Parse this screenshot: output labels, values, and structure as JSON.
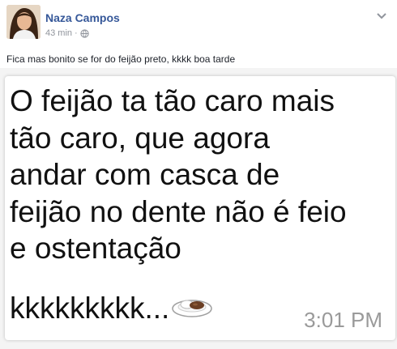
{
  "post": {
    "author": "Naza Campos",
    "time": "43 min",
    "separator": "·",
    "caption": "Fica mas bonito se for do feijão preto, kkkk boa tarde"
  },
  "image": {
    "message": "O feijão ta tão caro mais\ntão caro, que agora\nandar com casca de\nfeijão no dente não é feio\ne ostentação",
    "laugh": "kkkkkkkkk...",
    "emoji": "rice-and-beans-plate-icon",
    "timestamp": "3:01 PM"
  },
  "icons": {
    "globe": "globe-icon",
    "menu": "chevron-down-icon"
  },
  "colors": {
    "author": "#365899",
    "meta": "#90949c",
    "timestamp": "#9a9a9a"
  }
}
